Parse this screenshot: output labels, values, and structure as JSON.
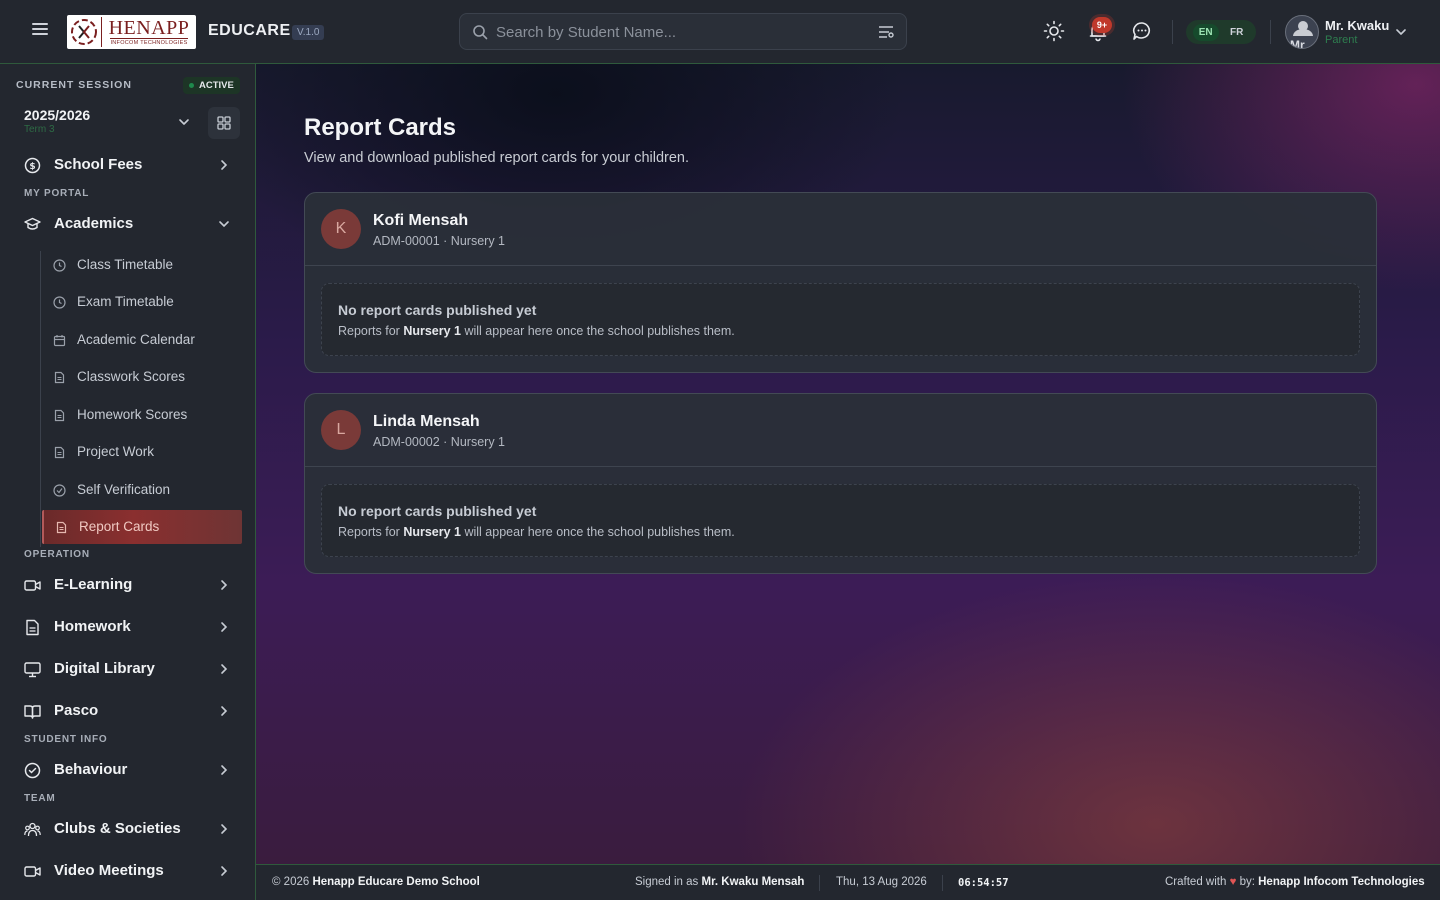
{
  "header": {
    "logo_word": "HENAPP",
    "logo_sub": "INFOCOM TECHNOLOGIES",
    "brand": "EDUCARE",
    "version": "V.1.0",
    "search_placeholder": "Search by Student Name...",
    "notification_count": "9+",
    "lang_en": "EN",
    "lang_fr": "FR",
    "avatar_text": "Mr",
    "user_name": "Mr. Kwaku",
    "user_role": "Parent"
  },
  "session": {
    "label": "CURRENT SESSION",
    "status": "ACTIVE",
    "year": "2025/2026",
    "term": "Term 3"
  },
  "sidebar": {
    "school_fees": "School Fees",
    "sections": {
      "my_portal": "MY PORTAL",
      "operation": "OPERATION",
      "student_info": "STUDENT INFO",
      "team": "TEAM"
    },
    "academics": "Academics",
    "academics_sub": [
      "Class Timetable",
      "Exam Timetable",
      "Academic Calendar",
      "Classwork Scores",
      "Homework Scores",
      "Project Work",
      "Self Verification",
      "Report Cards"
    ],
    "e_learning": "E-Learning",
    "homework": "Homework",
    "digital_library": "Digital Library",
    "pasco": "Pasco",
    "behaviour": "Behaviour",
    "clubs": "Clubs & Societies",
    "video_meetings": "Video Meetings"
  },
  "main": {
    "title": "Report Cards",
    "subtitle": "View and download published report cards for your children.",
    "students": [
      {
        "initial": "K",
        "name": "Kofi Mensah",
        "meta": "ADM-00001 · Nursery 1",
        "empty_title": "No report cards published yet",
        "empty_pre": "Reports for ",
        "empty_class": "Nursery 1",
        "empty_post": " will appear here once the school publishes them."
      },
      {
        "initial": "L",
        "name": "Linda Mensah",
        "meta": "ADM-00002 · Nursery 1",
        "empty_title": "No report cards published yet",
        "empty_pre": "Reports for ",
        "empty_class": "Nursery 1",
        "empty_post": " will appear here once the school publishes them."
      }
    ]
  },
  "footer": {
    "copyright_pre": "© 2026 ",
    "school": "Henapp Educare Demo School",
    "signed_pre": "Signed in as ",
    "signed_user": "Mr. Kwaku Mensah",
    "date": "Thu, 13 Aug 2026",
    "time": "06:54:57",
    "crafted_pre": "Crafted with ",
    "crafted_mid": " by: ",
    "company": "Henapp Infocom Technologies"
  },
  "colors": {
    "accent_green": "#2f5a3c",
    "active_item": "#8a2f2f",
    "badge_red": "#c0392b"
  }
}
